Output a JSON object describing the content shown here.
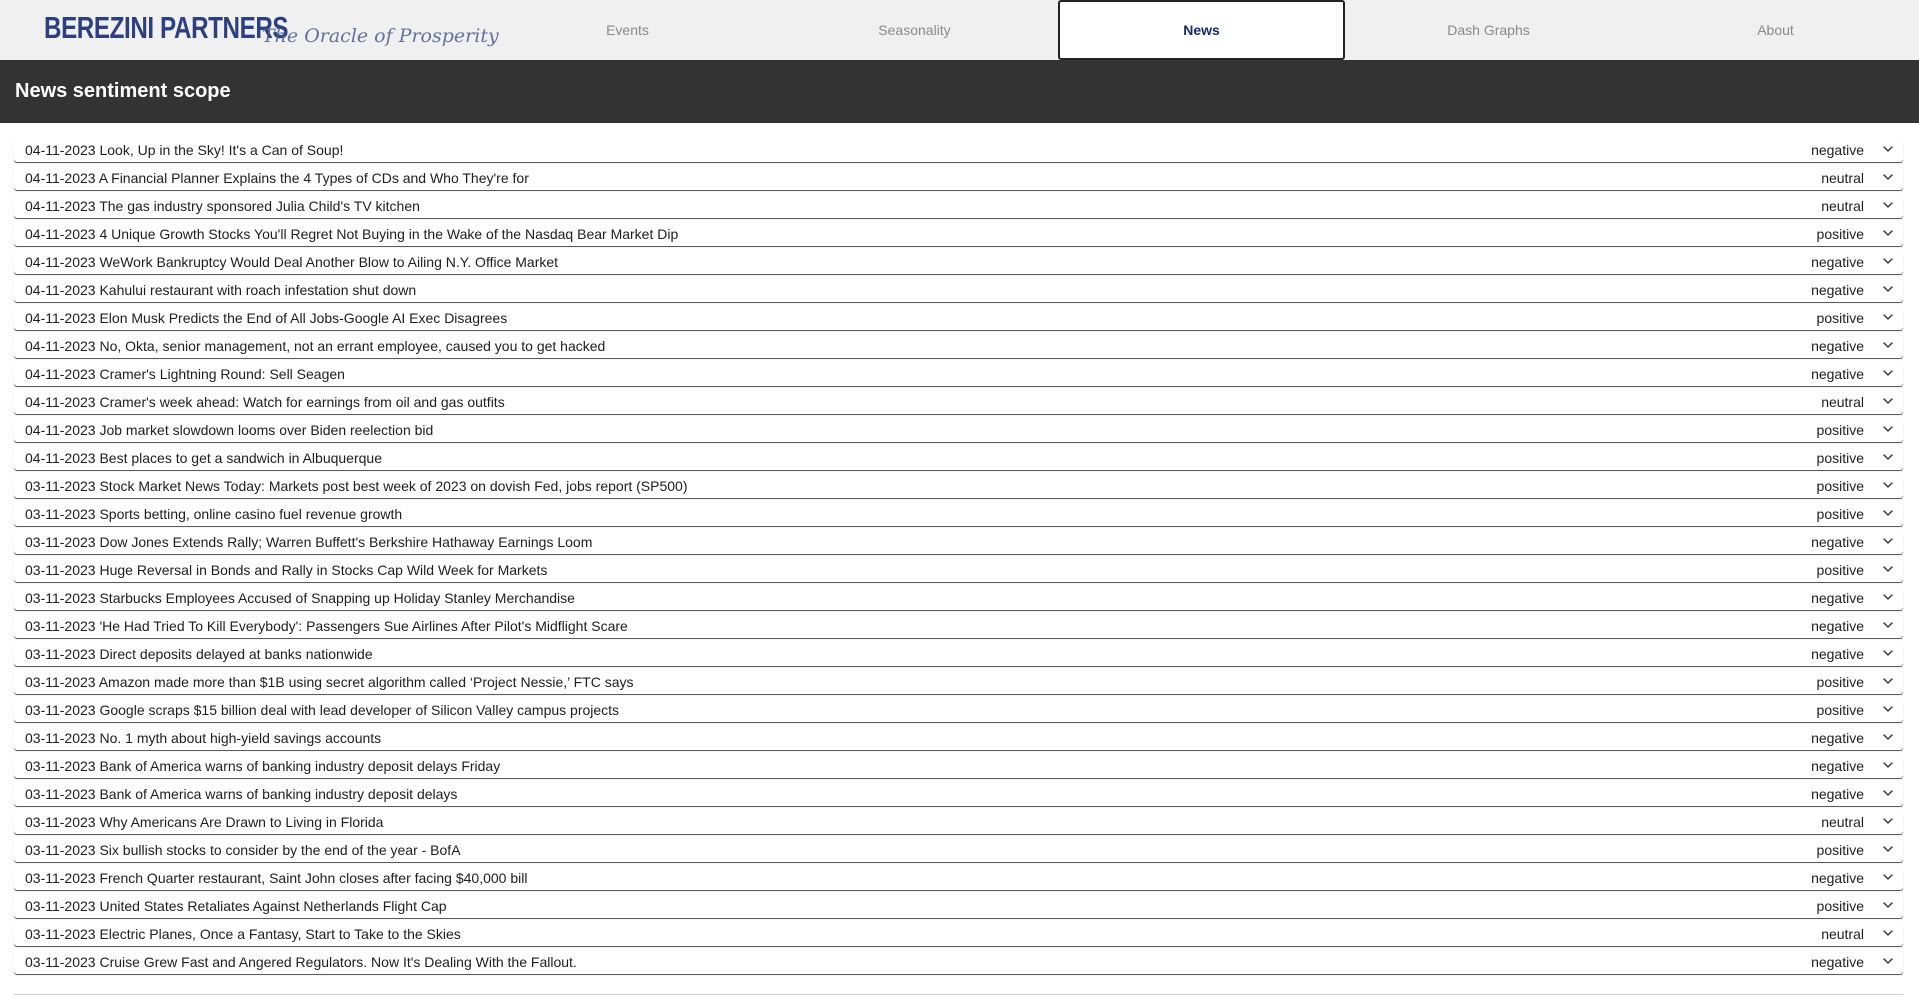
{
  "brand": {
    "name": "BEREZINI PARTNERS",
    "tagline": "The Oracle of Prosperity",
    "color": "#2c3f80"
  },
  "nav": {
    "tabs": [
      {
        "label": "Events",
        "active": false
      },
      {
        "label": "Seasonality",
        "active": false
      },
      {
        "label": "News",
        "active": true
      },
      {
        "label": "Dash Graphs",
        "active": false
      },
      {
        "label": "About",
        "active": false
      }
    ]
  },
  "header": {
    "title": "News sentiment scope"
  },
  "news": [
    {
      "text": "04-11-2023 Look, Up in the Sky! It's a Can of Soup!",
      "sentiment": "negative"
    },
    {
      "text": "04-11-2023 A Financial Planner Explains the 4 Types of CDs and Who They're for",
      "sentiment": "neutral"
    },
    {
      "text": "04-11-2023 The gas industry sponsored Julia Child's TV kitchen",
      "sentiment": "neutral"
    },
    {
      "text": "04-11-2023 4 Unique Growth Stocks You'll Regret Not Buying in the Wake of the Nasdaq Bear Market Dip",
      "sentiment": "positive"
    },
    {
      "text": "04-11-2023 WeWork Bankruptcy Would Deal Another Blow to Ailing N.Y. Office Market",
      "sentiment": "negative"
    },
    {
      "text": "04-11-2023 Kahului restaurant with roach infestation shut down",
      "sentiment": "negative"
    },
    {
      "text": "04-11-2023 Elon Musk Predicts the End of All Jobs-Google AI Exec Disagrees",
      "sentiment": "positive"
    },
    {
      "text": "04-11-2023 No, Okta, senior management, not an errant employee, caused you to get hacked",
      "sentiment": "negative"
    },
    {
      "text": "04-11-2023 Cramer's Lightning Round: Sell Seagen",
      "sentiment": "negative"
    },
    {
      "text": "04-11-2023 Cramer's week ahead: Watch for earnings from oil and gas outfits",
      "sentiment": "neutral"
    },
    {
      "text": "04-11-2023 Job market slowdown looms over Biden reelection bid",
      "sentiment": "positive"
    },
    {
      "text": "04-11-2023 Best places to get a sandwich in Albuquerque",
      "sentiment": "positive"
    },
    {
      "text": "03-11-2023 Stock Market News Today: Markets post best week of 2023 on dovish Fed, jobs report (SP500)",
      "sentiment": "positive"
    },
    {
      "text": "03-11-2023 Sports betting, online casino fuel revenue growth",
      "sentiment": "positive"
    },
    {
      "text": "03-11-2023 Dow Jones Extends Rally; Warren Buffett's Berkshire Hathaway Earnings Loom",
      "sentiment": "negative"
    },
    {
      "text": "03-11-2023 Huge Reversal in Bonds and Rally in Stocks Cap Wild Week for Markets",
      "sentiment": "positive"
    },
    {
      "text": "03-11-2023 Starbucks Employees Accused of Snapping up Holiday Stanley Merchandise",
      "sentiment": "negative"
    },
    {
      "text": "03-11-2023 'He Had Tried To Kill Everybody': Passengers Sue Airlines After Pilot's Midflight Scare",
      "sentiment": "negative"
    },
    {
      "text": "03-11-2023 Direct deposits delayed at banks nationwide",
      "sentiment": "negative"
    },
    {
      "text": "03-11-2023 Amazon made more than $1B using secret algorithm called ‘Project Nessie,’ FTC says",
      "sentiment": "positive"
    },
    {
      "text": "03-11-2023 Google scraps $15 billion deal with lead developer of Silicon Valley campus projects",
      "sentiment": "positive"
    },
    {
      "text": "03-11-2023 No. 1 myth about high-yield savings accounts",
      "sentiment": "negative"
    },
    {
      "text": "03-11-2023 Bank of America warns of banking industry deposit delays Friday",
      "sentiment": "negative"
    },
    {
      "text": "03-11-2023 Bank of America warns of banking industry deposit delays",
      "sentiment": "negative"
    },
    {
      "text": "03-11-2023 Why Americans Are Drawn to Living in Florida",
      "sentiment": "neutral"
    },
    {
      "text": "03-11-2023 Six bullish stocks to consider by the end of the year - BofA",
      "sentiment": "positive"
    },
    {
      "text": "03-11-2023 French Quarter restaurant, Saint John closes after facing $40,000 bill",
      "sentiment": "negative"
    },
    {
      "text": "03-11-2023 United States Retaliates Against Netherlands Flight Cap",
      "sentiment": "positive"
    },
    {
      "text": "03-11-2023 Electric Planes, Once a Fantasy, Start to Take to the Skies",
      "sentiment": "neutral"
    },
    {
      "text": "03-11-2023 Cruise Grew Fast and Angered Regulators. Now It's Dealing With the Fallout.",
      "sentiment": "negative"
    }
  ],
  "icons": {
    "expand": "chevron-down-icon"
  }
}
